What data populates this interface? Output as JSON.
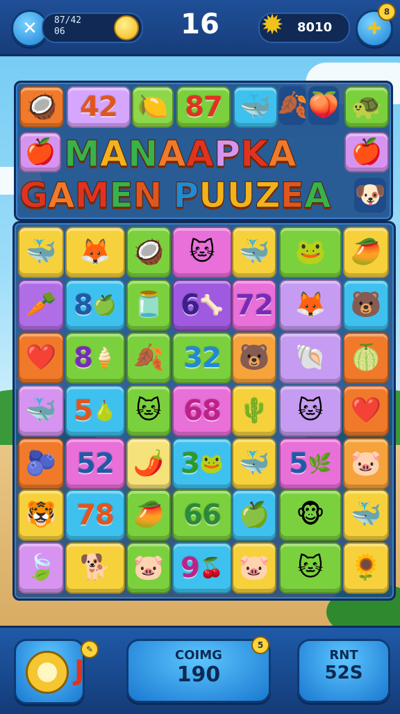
{
  "top_bar": {
    "close_icon": "close-x-icon",
    "left_stats": {
      "line1": "87/42",
      "line2": "06"
    },
    "level": "16",
    "score": "8010",
    "corner_badge": "8"
  },
  "title": {
    "line1": [
      "M",
      "A",
      "N",
      "A",
      "A",
      "P",
      "K",
      "A"
    ],
    "line2": [
      "G",
      "A",
      "M",
      "E",
      "N",
      "P",
      "U",
      "U",
      "Z",
      "E",
      "A"
    ]
  },
  "header_tiles": [
    {
      "text": "",
      "icon": "🥥",
      "color": "#f07a2a"
    },
    {
      "text": "42",
      "icon": "",
      "color": "#d6a6ff",
      "fg": "#e0561f"
    },
    {
      "text": "",
      "icon": "🍋",
      "color": "#8ed64a"
    },
    {
      "text": "87",
      "icon": "",
      "color": "#7bd13d",
      "fg": "#e0331f"
    },
    {
      "text": "",
      "icon": "🐳",
      "color": "#3fc1ef"
    },
    {
      "text": "",
      "icon": "🍂",
      "color": "#1e4b8a"
    },
    {
      "text": "",
      "icon": "🍑",
      "color": "#1e4b8a"
    },
    {
      "text": "",
      "icon": "🐢",
      "color": "#7bd13d"
    },
    {
      "text": "",
      "icon": "🍎",
      "color": "#d694f0"
    },
    {
      "text": "",
      "icon": "🍎",
      "color": "#d694f0"
    },
    {
      "text": "",
      "icon": "🐶",
      "color": "#1e4b8a"
    }
  ],
  "board": [
    [
      {
        "text": "",
        "icon": "🐳",
        "color": "#f6d13c"
      },
      {
        "text": "",
        "icon": "🦊",
        "color": "#f6d13c"
      },
      {
        "text": "",
        "icon": "🥥",
        "color": "#7bd13d"
      },
      {
        "text": "",
        "icon": "🐱",
        "color": "#e96fd9"
      },
      {
        "text": "",
        "icon": "🐳",
        "color": "#f6d13c"
      },
      {
        "text": "",
        "icon": "🐸",
        "color": "#7bd13d"
      },
      {
        "text": "",
        "icon": "🥭",
        "color": "#f6d13c"
      }
    ],
    [
      {
        "text": "",
        "icon": "🥕",
        "color": "#b06ee6"
      },
      {
        "text": "8",
        "icon": "🍏",
        "color": "#3fc1ef",
        "fg": "#1f5aa8"
      },
      {
        "text": "",
        "icon": "🫙",
        "color": "#7bd13d"
      },
      {
        "text": "6",
        "icon": "🦴",
        "color": "#a05ae0",
        "fg": "#3b1f8a"
      },
      {
        "text": "72",
        "icon": "",
        "color": "#e96fd9",
        "fg": "#7a2ab8"
      },
      {
        "text": "",
        "icon": "🦊",
        "color": "#c69cf2"
      },
      {
        "text": "",
        "icon": "🐻",
        "color": "#3fc1ef"
      }
    ],
    [
      {
        "text": "",
        "icon": "❤️",
        "color": "#f07a2a"
      },
      {
        "text": "8",
        "icon": "🍦",
        "color": "#7bd13d",
        "fg": "#7a2ab8"
      },
      {
        "text": "",
        "icon": "🍂",
        "color": "#7bd13d"
      },
      {
        "text": "32",
        "icon": "",
        "color": "#7bd13d",
        "fg": "#1f8ad6"
      },
      {
        "text": "",
        "icon": "🐻",
        "color": "#f6a33c"
      },
      {
        "text": "",
        "icon": "🐚",
        "color": "#c69cf2"
      },
      {
        "text": "",
        "icon": "🍈",
        "color": "#f07a2a"
      }
    ],
    [
      {
        "text": "",
        "icon": "🐳",
        "color": "#d694f0"
      },
      {
        "text": "5",
        "icon": "🍐",
        "color": "#3fc1ef",
        "fg": "#e0561f"
      },
      {
        "text": "",
        "icon": "🐱",
        "color": "#7bd13d"
      },
      {
        "text": "68",
        "icon": "",
        "color": "#e96fd9",
        "fg": "#c0208a"
      },
      {
        "text": "",
        "icon": "🌵",
        "color": "#f6d13c"
      },
      {
        "text": "",
        "icon": "🐱",
        "color": "#c69cf2"
      },
      {
        "text": "",
        "icon": "❤️",
        "color": "#f07a2a"
      }
    ],
    [
      {
        "text": "",
        "icon": "🫐",
        "color": "#f07a2a"
      },
      {
        "text": "52",
        "icon": "",
        "color": "#e96fd9",
        "fg": "#1f5aa8"
      },
      {
        "text": "",
        "icon": "🌶️",
        "color": "#f6e27a"
      },
      {
        "text": "3",
        "icon": "🐸",
        "color": "#3fc1ef",
        "fg": "#2a9a2a"
      },
      {
        "text": "",
        "icon": "🐳",
        "color": "#f6d13c"
      },
      {
        "text": "5",
        "icon": "🌿",
        "color": "#e96fd9",
        "fg": "#1f5aa8"
      },
      {
        "text": "",
        "icon": "🐷",
        "color": "#f6a33c"
      }
    ],
    [
      {
        "text": "",
        "icon": "🐯",
        "color": "#f6d13c"
      },
      {
        "text": "78",
        "icon": "",
        "color": "#3fc1ef",
        "fg": "#e0561f"
      },
      {
        "text": "",
        "icon": "🥭",
        "color": "#7bd13d"
      },
      {
        "text": "66",
        "icon": "",
        "color": "#7bd13d",
        "fg": "#2a8a3a"
      },
      {
        "text": "",
        "icon": "🍏",
        "color": "#3fc1ef"
      },
      {
        "text": "",
        "icon": "🐵",
        "color": "#7bd13d"
      },
      {
        "text": "",
        "icon": "🐳",
        "color": "#f6d13c"
      }
    ],
    [
      {
        "text": "",
        "icon": "🍃",
        "color": "#d694f0"
      },
      {
        "text": "",
        "icon": "🐕",
        "color": "#f6d13c"
      },
      {
        "text": "",
        "icon": "🐷",
        "color": "#7bd13d"
      },
      {
        "text": "9",
        "icon": "🍒",
        "color": "#3fc1ef",
        "fg": "#c0208a"
      },
      {
        "text": "",
        "icon": "🐷",
        "color": "#f6d13c"
      },
      {
        "text": "",
        "icon": "🐱",
        "color": "#7bd13d"
      },
      {
        "text": "",
        "icon": "🌻",
        "color": "#f6d13c"
      }
    ]
  ],
  "bottom": {
    "left_badge": "J",
    "coins_label": "COIMG",
    "coins_value": "190",
    "coins_badge": "5",
    "rnt_label": "RNT",
    "rnt_value": "52S"
  },
  "colors": {
    "topbar": "#1f4f98",
    "panel": "#184682",
    "accent": "#ffd43b"
  }
}
